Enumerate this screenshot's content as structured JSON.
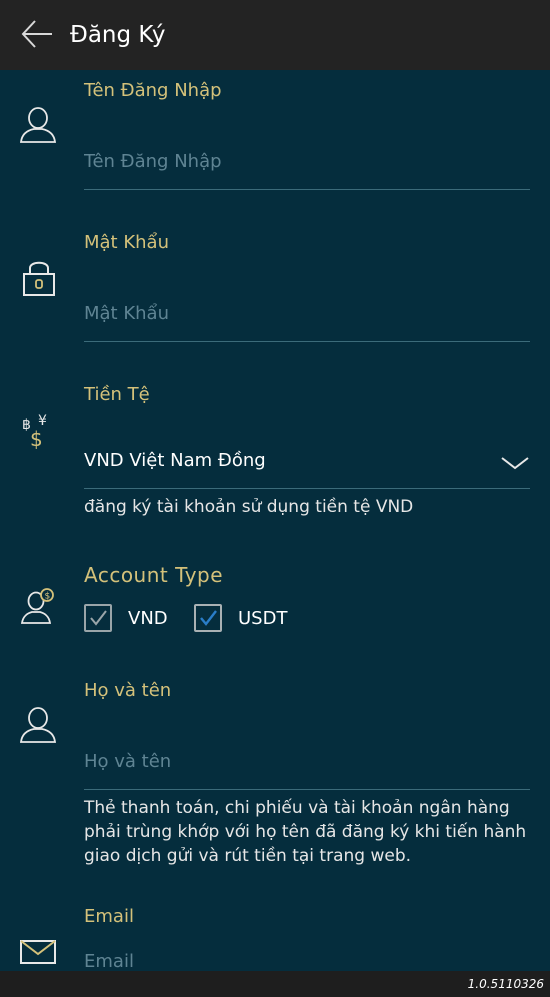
{
  "header": {
    "title": "Đăng Ký"
  },
  "form": {
    "username": {
      "label": "Tên Đăng Nhập",
      "placeholder": "Tên Đăng Nhập"
    },
    "password": {
      "label": "Mật Khẩu",
      "placeholder": "Mật Khẩu"
    },
    "currency": {
      "label": "Tiền Tệ",
      "selected": "VND Việt Nam Đồng",
      "helper": "đăng ký tài khoản sử dụng tiền tệ VND"
    },
    "account_type": {
      "label": "Account Type",
      "options": [
        {
          "label": "VND",
          "checked": true
        },
        {
          "label": "USDT",
          "checked": true
        }
      ]
    },
    "fullname": {
      "label": "Họ và tên",
      "placeholder": "Họ và tên",
      "helper": "Thẻ thanh toán, chi phiếu và tài khoản ngân hàng phải trùng khớp với họ tên đã đăng ký khi tiến hành giao dịch gửi và rút tiền tại trang web."
    },
    "email": {
      "label": "Email",
      "placeholder": "Email"
    }
  },
  "footer": {
    "version": "1.0.5110326"
  },
  "colors": {
    "background": "#052d3d",
    "header": "#232323",
    "label": "#d4c17a",
    "checkbox_active": "#2a7dc8"
  },
  "icons": [
    "back-arrow-icon",
    "user-icon",
    "lock-icon",
    "currency-icon",
    "user-coin-icon",
    "user-icon",
    "envelope-icon",
    "chevron-down-icon",
    "checkmark-icon"
  ]
}
